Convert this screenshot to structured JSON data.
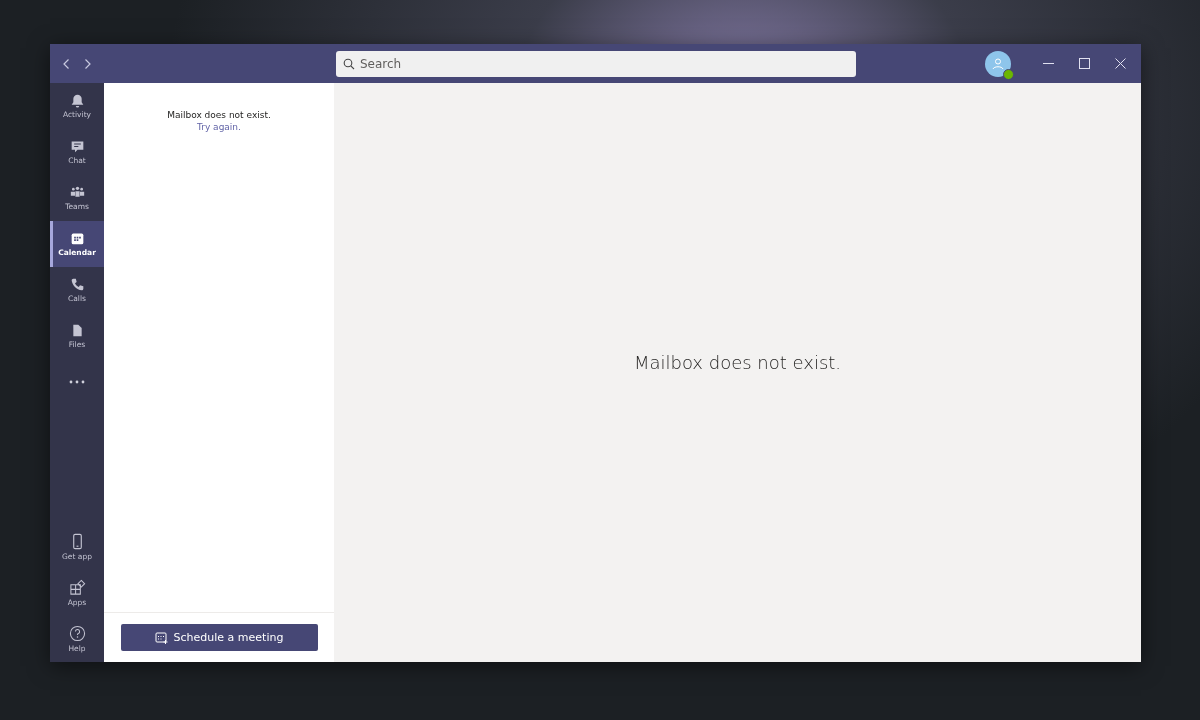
{
  "title_bar": {
    "search": {
      "placeholder": "Search"
    },
    "profile": {
      "online": true
    }
  },
  "app_bar": {
    "items": [
      {
        "label": "Activity",
        "selected": false
      },
      {
        "label": "Chat",
        "selected": false
      },
      {
        "label": "Teams",
        "selected": false
      },
      {
        "label": "Calendar",
        "selected": true
      },
      {
        "label": "Calls",
        "selected": false
      },
      {
        "label": "Files",
        "selected": false
      }
    ],
    "bottom_items": [
      {
        "label": "Get app"
      },
      {
        "label": "Apps"
      },
      {
        "label": "Help"
      }
    ]
  },
  "side_panel": {
    "message": "Mailbox does not exist.",
    "link": "Try again.",
    "button": "Schedule a meeting"
  },
  "main": {
    "message": "Mailbox does not exist."
  }
}
